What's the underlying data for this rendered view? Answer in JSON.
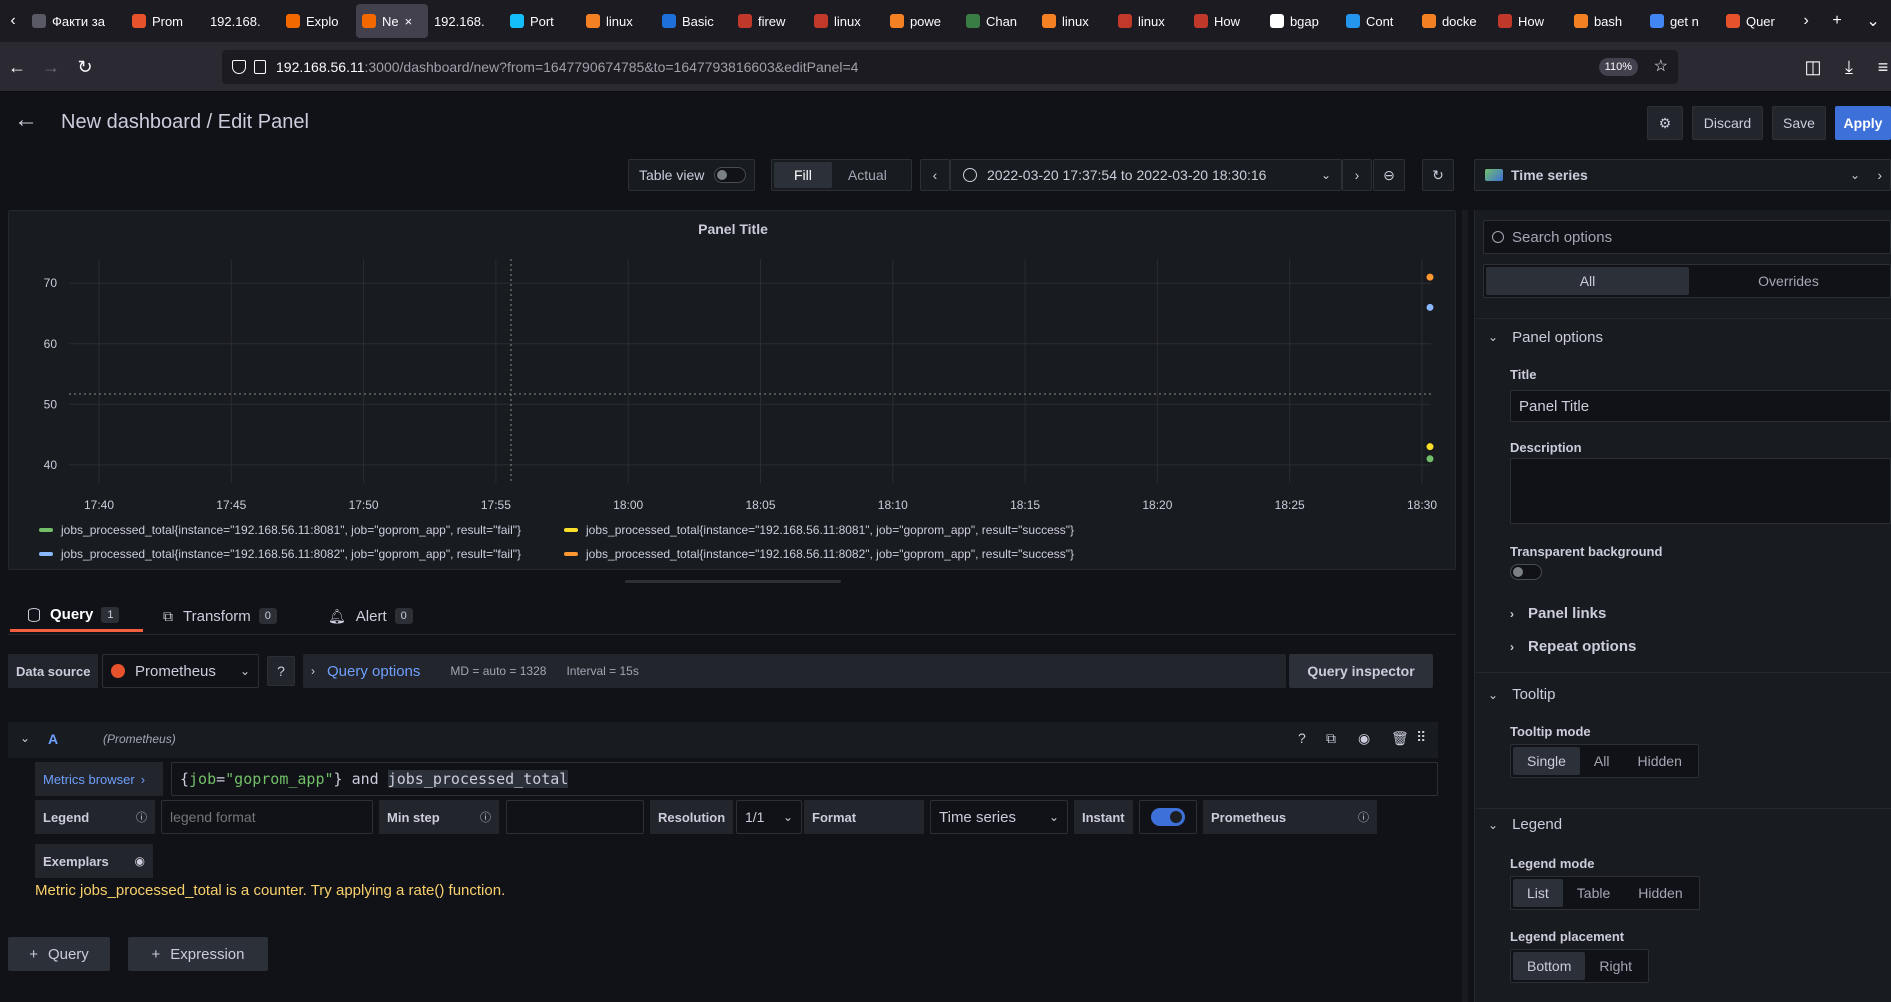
{
  "browser": {
    "tabs": [
      {
        "label": "Факти за",
        "icon": "page-icon",
        "color": "#5a5a66",
        "width": 100
      },
      {
        "label": "Prom",
        "icon": "prometheus-icon",
        "color": "#e6522c",
        "width": 78
      },
      {
        "label": "192.168.",
        "icon": "",
        "color": "",
        "width": 76
      },
      {
        "label": "Explo",
        "icon": "grafana-icon",
        "color": "#f46800",
        "width": 76
      },
      {
        "label": "Ne",
        "icon": "grafana-icon",
        "color": "#f46800",
        "width": 72,
        "active": true
      },
      {
        "label": "192.168.",
        "icon": "",
        "color": "",
        "width": 76
      },
      {
        "label": "Port",
        "icon": "portainer-icon",
        "color": "#13bef9",
        "width": 76
      },
      {
        "label": "linux",
        "icon": "stackoverflow-icon",
        "color": "#f48024",
        "width": 76
      },
      {
        "label": "Basic",
        "icon": "vuln-icon",
        "color": "#1e6fd9",
        "width": 76
      },
      {
        "label": "firew",
        "icon": "page-icon",
        "color": "#c0392b",
        "width": 76
      },
      {
        "label": "linux",
        "icon": "page-icon",
        "color": "#c0392b",
        "width": 76
      },
      {
        "label": "powe",
        "icon": "stackoverflow-icon",
        "color": "#f48024",
        "width": 76
      },
      {
        "label": "Chan",
        "icon": "page-icon",
        "color": "#3a7d44",
        "width": 76
      },
      {
        "label": "linux",
        "icon": "stackoverflow-icon",
        "color": "#f48024",
        "width": 76
      },
      {
        "label": "linux",
        "icon": "page-icon",
        "color": "#c0392b",
        "width": 76
      },
      {
        "label": "How",
        "icon": "page-icon",
        "color": "#c0392b",
        "width": 76
      },
      {
        "label": "bgap",
        "icon": "github-icon",
        "color": "#ffffff",
        "width": 76
      },
      {
        "label": "Cont",
        "icon": "docker-icon",
        "color": "#2496ed",
        "width": 76
      },
      {
        "label": "docke",
        "icon": "stackoverflow-icon",
        "color": "#f48024",
        "width": 76
      },
      {
        "label": "How",
        "icon": "page-icon",
        "color": "#c0392b",
        "width": 76
      },
      {
        "label": "bash",
        "icon": "stackoverflow-icon",
        "color": "#f48024",
        "width": 76
      },
      {
        "label": "get n",
        "icon": "google-icon",
        "color": "#4285f4",
        "width": 76
      },
      {
        "label": "Quer",
        "icon": "prometheus-icon",
        "color": "#e6522c",
        "width": 76
      }
    ],
    "url_host": "192.168.56.11",
    "url_path": ":3000/dashboard/new?from=1647790674785&to=1647793816603&editPanel=4",
    "zoom": "110%"
  },
  "header": {
    "title": "New dashboard / Edit Panel",
    "discard": "Discard",
    "save": "Save",
    "apply": "Apply"
  },
  "toolbar": {
    "table_view": "Table view",
    "fill": "Fill",
    "actual": "Actual",
    "time_range": "2022-03-20 17:37:54 to 2022-03-20 18:30:16",
    "viz": "Time series"
  },
  "chart_data": {
    "type": "line",
    "title": "Panel Title",
    "xlabel": "",
    "ylabel": "",
    "x_ticks": [
      "17:40",
      "17:45",
      "17:50",
      "17:55",
      "18:00",
      "18:05",
      "18:10",
      "18:15",
      "18:20",
      "18:25",
      "18:30"
    ],
    "y_ticks": [
      40,
      50,
      60,
      70
    ],
    "ylim": [
      37,
      74
    ],
    "series": [
      {
        "name": "jobs_processed_total{instance=\"192.168.56.11:8081\", job=\"goprom_app\", result=\"fail\"}",
        "color": "#73bf69",
        "x": "18:30",
        "value": 41
      },
      {
        "name": "jobs_processed_total{instance=\"192.168.56.11:8081\", job=\"goprom_app\", result=\"success\"}",
        "color": "#fade2a",
        "x": "18:30",
        "value": 43
      },
      {
        "name": "jobs_processed_total{instance=\"192.168.56.11:8082\", job=\"goprom_app\", result=\"fail\"}",
        "color": "#8ab8ff",
        "x": "18:30",
        "value": 66
      },
      {
        "name": "jobs_processed_total{instance=\"192.168.56.11:8082\", job=\"goprom_app\", result=\"success\"}",
        "color": "#ff9830",
        "x": "18:30",
        "value": 71
      }
    ],
    "grid": true
  },
  "query": {
    "tab_query": "Query",
    "tab_query_count": "1",
    "tab_transform": "Transform",
    "tab_transform_count": "0",
    "tab_alert": "Alert",
    "tab_alert_count": "0",
    "datasource_label": "Data source",
    "datasource": "Prometheus",
    "query_options": "Query options",
    "md": "MD = auto = 1328",
    "interval": "Interval = 15s",
    "inspector": "Query inspector",
    "ref": "A",
    "ref_ds": "(Prometheus)",
    "metrics_browser": "Metrics browser",
    "expr_open": "{",
    "expr_key": "job",
    "expr_eq": "=",
    "expr_val": "\"goprom_app\"",
    "expr_close": "} and ",
    "expr_metric": "jobs_processed_total",
    "legend": "Legend",
    "legend_placeholder": "legend format",
    "min_step": "Min step",
    "resolution": "Resolution",
    "resolution_value": "1/1",
    "format": "Format",
    "format_value": "Time series",
    "instant": "Instant",
    "instant_on": true,
    "prometheus": "Prometheus",
    "exemplars": "Exemplars",
    "warning": "Metric jobs_processed_total is a counter. Try applying a rate() function.",
    "add_query": "Query",
    "add_expression": "Expression"
  },
  "options": {
    "search_placeholder": "Search options",
    "tab_all": "All",
    "tab_overrides": "Overrides",
    "panel_options": "Panel options",
    "title_label": "Title",
    "title_value": "Panel Title",
    "description_label": "Description",
    "transparent_label": "Transparent background",
    "panel_links": "Panel links",
    "repeat_options": "Repeat options",
    "tooltip": "Tooltip",
    "tooltip_mode": "Tooltip mode",
    "tooltip_modes": [
      "Single",
      "All",
      "Hidden"
    ],
    "legend": "Legend",
    "legend_mode": "Legend mode",
    "legend_modes": [
      "List",
      "Table",
      "Hidden"
    ],
    "legend_placement": "Legend placement",
    "legend_placements": [
      "Bottom",
      "Right"
    ]
  }
}
